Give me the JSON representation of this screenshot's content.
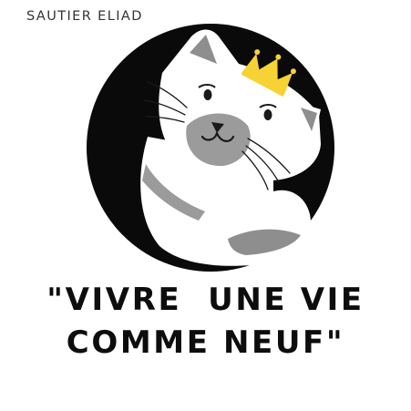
{
  "header": {
    "author": "SAUTIER ELIAD"
  },
  "logo": {
    "icon": "crowned-cat-icon",
    "colors": {
      "circle": "#0a0a0a",
      "cat_body": "#ffffff",
      "cat_gray": "#9b9b9b",
      "crown": "#f7d234"
    }
  },
  "quote": {
    "line1": "\"VIVRE  UNE VIE",
    "line2": "COMME NEUF\""
  }
}
